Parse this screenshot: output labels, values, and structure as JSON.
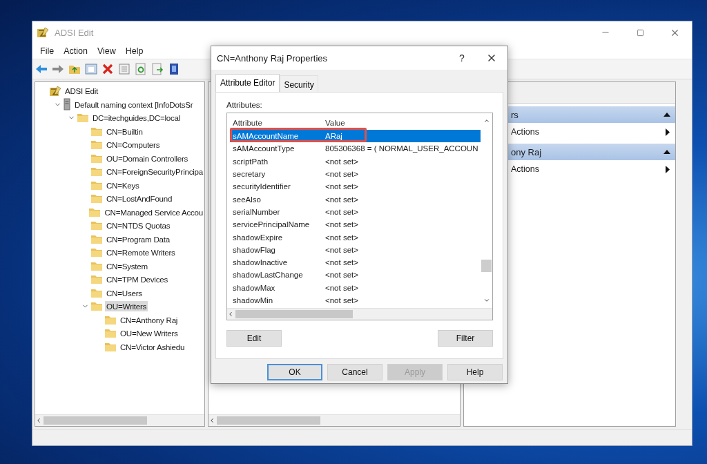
{
  "main_window": {
    "title": "ADSI Edit",
    "menu": [
      "File",
      "Action",
      "View",
      "Help"
    ],
    "tree": [
      {
        "label": "ADSI Edit",
        "kind": "adsi",
        "selected": false,
        "children": [
          {
            "label": "Default naming context [InfoDotsSr",
            "kind": "server",
            "selected": false,
            "expanded": true,
            "children": [
              {
                "label": "DC=itechguides,DC=local",
                "kind": "folder",
                "selected": false,
                "expanded": true,
                "children": [
                  {
                    "label": "CN=Builtin",
                    "kind": "folder",
                    "selected": false
                  },
                  {
                    "label": "CN=Computers",
                    "kind": "folder",
                    "selected": false
                  },
                  {
                    "label": "OU=Domain Controllers",
                    "kind": "folder",
                    "selected": false
                  },
                  {
                    "label": "CN=ForeignSecurityPrincipa",
                    "kind": "folder",
                    "selected": false
                  },
                  {
                    "label": "CN=Keys",
                    "kind": "folder",
                    "selected": false
                  },
                  {
                    "label": "CN=LostAndFound",
                    "kind": "folder",
                    "selected": false
                  },
                  {
                    "label": "CN=Managed Service Accou",
                    "kind": "folder",
                    "selected": false
                  },
                  {
                    "label": "CN=NTDS Quotas",
                    "kind": "folder",
                    "selected": false
                  },
                  {
                    "label": "CN=Program Data",
                    "kind": "folder",
                    "selected": false
                  },
                  {
                    "label": "CN=Remote Writers",
                    "kind": "folder",
                    "selected": false
                  },
                  {
                    "label": "CN=System",
                    "kind": "folder",
                    "selected": false
                  },
                  {
                    "label": "CN=TPM Devices",
                    "kind": "folder",
                    "selected": false
                  },
                  {
                    "label": "CN=Users",
                    "kind": "folder",
                    "selected": false
                  },
                  {
                    "label": "OU=Writers",
                    "kind": "folder",
                    "selected": true,
                    "expanded": true,
                    "children": [
                      {
                        "label": "CN=Anthony Raj",
                        "kind": "folder",
                        "selected": false
                      },
                      {
                        "label": "OU=New Writers",
                        "kind": "folder",
                        "selected": false
                      },
                      {
                        "label": "CN=Victor Ashiedu",
                        "kind": "folder",
                        "selected": false
                      }
                    ]
                  }
                ]
              }
            ]
          }
        ]
      }
    ],
    "actions": [
      {
        "title": "rs",
        "items": [
          "Actions"
        ]
      },
      {
        "title": "ony Raj",
        "items": [
          "Actions"
        ]
      }
    ]
  },
  "dialog": {
    "title": "CN=Anthony Raj Properties",
    "help": "?",
    "tabs": [
      {
        "label": "Attribute Editor",
        "selected": true
      },
      {
        "label": "Security",
        "selected": false
      }
    ],
    "attributes_label": "Attributes:",
    "columns": [
      "Attribute",
      "Value"
    ],
    "rows": [
      {
        "attribute": "sAMAccountName",
        "value": "ARaj",
        "selected": true,
        "highlighted": true
      },
      {
        "attribute": "sAMAccountType",
        "value": "805306368 = ( NORMAL_USER_ACCOUN",
        "selected": false,
        "highlighted": false
      },
      {
        "attribute": "scriptPath",
        "value": "<not set>",
        "selected": false,
        "highlighted": false
      },
      {
        "attribute": "secretary",
        "value": "<not set>",
        "selected": false,
        "highlighted": false
      },
      {
        "attribute": "securityIdentifier",
        "value": "<not set>",
        "selected": false,
        "highlighted": false
      },
      {
        "attribute": "seeAlso",
        "value": "<not set>",
        "selected": false,
        "highlighted": false
      },
      {
        "attribute": "serialNumber",
        "value": "<not set>",
        "selected": false,
        "highlighted": false
      },
      {
        "attribute": "servicePrincipalName",
        "value": "<not set>",
        "selected": false,
        "highlighted": false
      },
      {
        "attribute": "shadowExpire",
        "value": "<not set>",
        "selected": false,
        "highlighted": false
      },
      {
        "attribute": "shadowFlag",
        "value": "<not set>",
        "selected": false,
        "highlighted": false
      },
      {
        "attribute": "shadowInactive",
        "value": "<not set>",
        "selected": false,
        "highlighted": false
      },
      {
        "attribute": "shadowLastChange",
        "value": "<not set>",
        "selected": false,
        "highlighted": false
      },
      {
        "attribute": "shadowMax",
        "value": "<not set>",
        "selected": false,
        "highlighted": false
      },
      {
        "attribute": "shadowMin",
        "value": "<not set>",
        "selected": false,
        "highlighted": false
      }
    ],
    "list_buttons": [
      "Edit",
      "Filter"
    ],
    "buttons": [
      {
        "label": "OK",
        "default": true,
        "disabled": false
      },
      {
        "label": "Cancel",
        "default": false,
        "disabled": false
      },
      {
        "label": "Apply",
        "default": false,
        "disabled": true
      },
      {
        "label": "Help",
        "default": false,
        "disabled": false
      }
    ]
  }
}
